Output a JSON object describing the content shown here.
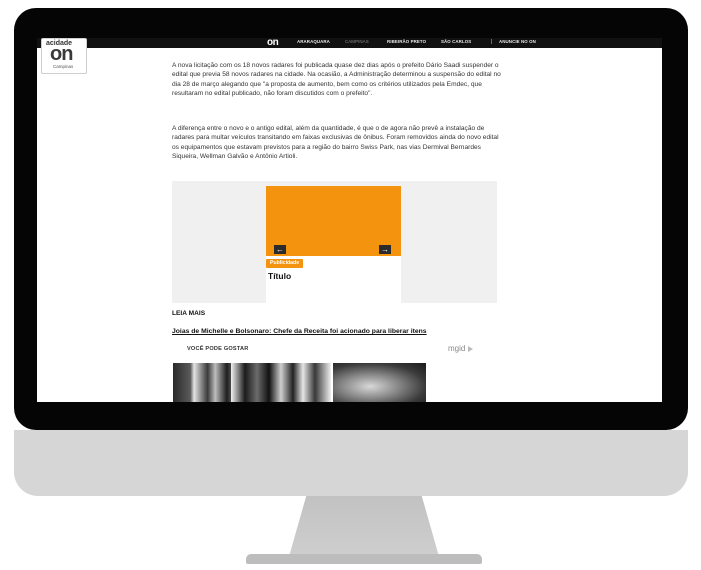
{
  "nav": {
    "logo": "on",
    "items": [
      "ARARAQUARA",
      "CAMPINAS",
      "RIBEIRÃO PRETO",
      "SÃO CARLOS"
    ],
    "separator": "|",
    "cta": "ANUNCIE NO ON"
  },
  "brand": {
    "top": "acidade",
    "logo": "on",
    "city": "Campinas"
  },
  "article": {
    "paragraphs": [
      "A nova licitação com os 18 novos radares foi publicada quase dez dias após o prefeito Dário Saadi suspender o edital que previa 58 novos radares na cidade. Na ocasião, a Administração determinou a suspensão do edital no dia 28 de março alegando que \"a proposta de aumento, bem como os critérios utilizados pela Emdec, que resultaram no edital publicado, não foram discutidos com o prefeito\".",
      "A diferença entre o novo e o antigo edital, além da quantidade, é que o de agora não prevê a instalação de radares para multar veículos transitando em faixas exclusivas de ônibus. Foram removidos ainda do novo edital os equipamentos que estavam previstos para a região do bairro Swiss Park, nas vias Dermival Bernardes Siqueira, Wellman Galvão e Antônio Artioli."
    ]
  },
  "ad": {
    "badge": "Publicidade",
    "title": "Título",
    "prev_icon": "arrow-left-icon",
    "next_icon": "arrow-right-icon",
    "accent": "#f4940e"
  },
  "leia_mais": {
    "heading": "LEIA MAIS",
    "link": "Joias de Michelle e Bolsonaro: Chefe da Receita foi acionado para liberar itens"
  },
  "recommend": {
    "heading": "VOCÊ PODE GOSTAR",
    "provider": "mgid"
  }
}
